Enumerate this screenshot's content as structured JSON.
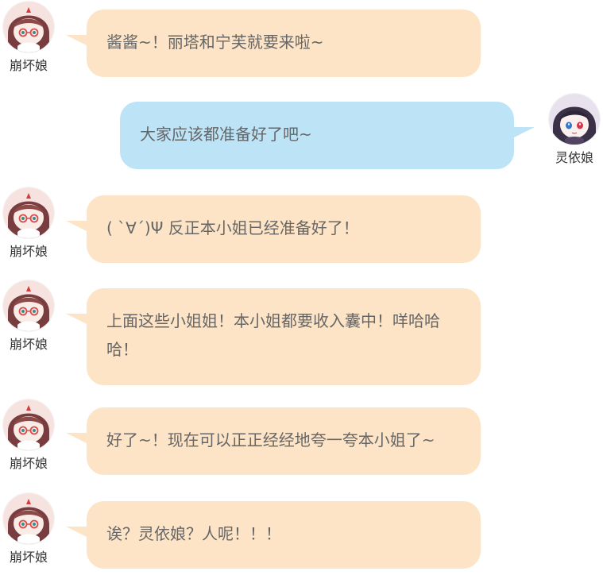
{
  "conversation": {
    "messages": [
      {
        "sender": "崩坏娘",
        "side": "left",
        "avatar_icon": "bengwainiang-avatar-icon",
        "text": "酱酱~！丽塔和宁芙就要来啦~"
      },
      {
        "sender": "灵依娘",
        "side": "right",
        "avatar_icon": "lingyiniang-avatar-icon",
        "text": "大家应该都准备好了吧~"
      },
      {
        "sender": "崩坏娘",
        "side": "left",
        "avatar_icon": "bengwainiang-avatar-icon",
        "text": "( `∀´)Ψ 反正本小姐已经准备好了！"
      },
      {
        "sender": "崩坏娘",
        "side": "left",
        "avatar_icon": "bengwainiang-avatar-icon",
        "text": "上面这些小姐姐！本小姐都要收入囊中！咩哈哈哈！"
      },
      {
        "sender": "崩坏娘",
        "side": "left",
        "avatar_icon": "bengwainiang-avatar-icon",
        "text": "好了~！现在可以正正经经地夸一夸本小姐了~"
      },
      {
        "sender": "崩坏娘",
        "side": "left",
        "avatar_icon": "bengwainiang-avatar-icon",
        "text": "诶？灵依娘？人呢！！！"
      }
    ]
  },
  "colors": {
    "left_bubble": "#fde4c6",
    "right_bubble": "#bde3f7",
    "message_text": "#666666",
    "name_text": "#333333"
  }
}
